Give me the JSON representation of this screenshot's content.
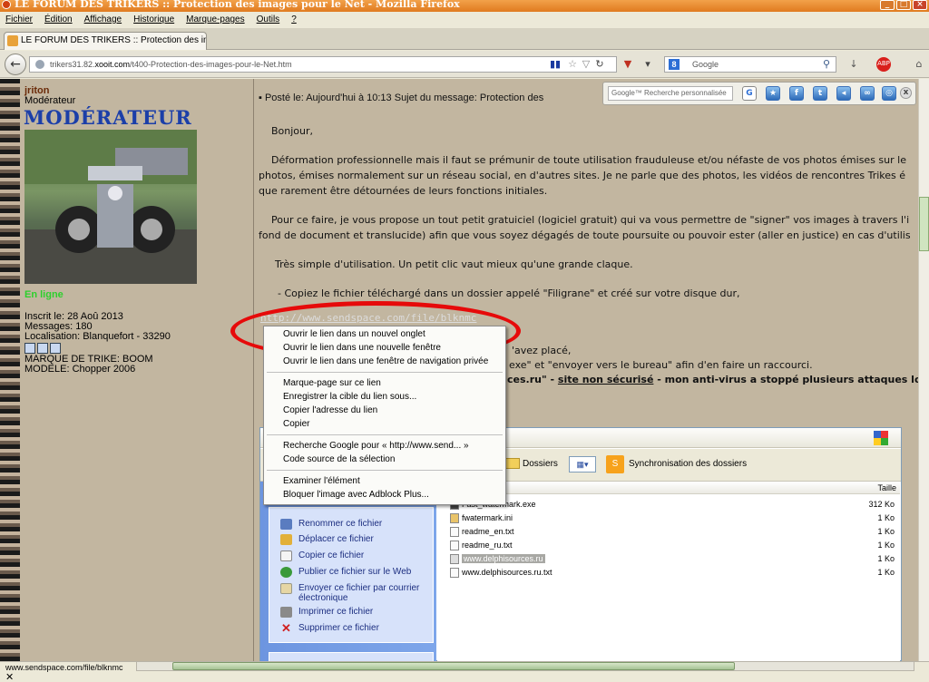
{
  "window": {
    "title": "LE FORUM DES TRIKERS :: Protection des images pour le Net - Mozilla Firefox"
  },
  "menubar": [
    "Fichier",
    "Édition",
    "Affichage",
    "Historique",
    "Marque-pages",
    "Outils",
    "?"
  ],
  "tab": {
    "label": "LE FORUM DES TRIKERS :: Protection des im..."
  },
  "nav": {
    "back_icon": "←",
    "url_prefix": "trikers31.82.",
    "url_domain": "xooit.com",
    "url_path": "/t400-Protection-des-images-pour-le-Net.htm",
    "search_engine_icon": "8",
    "search_placeholder": "Google"
  },
  "poster": {
    "name": "jriton",
    "rank": "Modérateur",
    "rank_image_text": "MODÉRATEUR",
    "status": "En ligne",
    "joined": "Inscrit le: 28 Aoû 2013",
    "messages": "Messages: 180",
    "location": "Localisation: Blanquefort - 33290",
    "trike": "MARQUE DE TRIKE: BOOM",
    "model": "MODELE: Chopper 2006"
  },
  "post": {
    "header": "Posté le: Aujourd'hui à 10:13    Sujet du message: Protection des",
    "lines": [
      "Bonjour,",
      "Déformation professionnelle mais il faut se prémunir de toute utilisation frauduleuse et/ou néfaste de vos photos émises sur le",
      "photos, émises normalement sur un réseau social, en d'autres sites. Je ne parle que des photos, les vidéos de rencontres Trikes é",
      "que rarement être détournées de leurs fonctions initiales.",
      "Pour ce faire, je vous propose un tout petit gratuiciel (logiciel gratuit) qui va vous permettre de \"signer\" vos images à travers l'i",
      "fond de document et translucide) afin que vous soyez dégagés de toute poursuite ou pouvoir ester (aller en justice) en cas d'utilis",
      "Très simple d'utilisation. Un petit clic vaut mieux qu'une grande claque.",
      "- Copiez le fichier téléchargé dans un dossier appelé \"Filigrane\" et créé sur votre disque dur,",
      "http://www.sendspace.com/file/blknmc",
      "'avez placé,",
      "exe\" et \"envoyer vers le bureau\" afin d'en faire un raccourci.",
      "ces.ru\" - ",
      "site non sécurisé",
      " - mon anti-virus a stoppé plusieurs attaques lors du"
    ]
  },
  "google_toolbar": {
    "search_label": "Google™ Recherche personnalisée",
    "buttons": [
      "G",
      "★",
      "f",
      "t",
      "◂",
      "∞",
      "◎",
      "x"
    ]
  },
  "context_menu": {
    "items": [
      "Ouvrir le lien dans un nouvel onglet",
      "Ouvrir le lien dans une nouvelle fenêtre",
      "Ouvrir le lien dans une fenêtre de navigation privée",
      "Marque-page sur ce lien",
      "Enregistrer la cible du lien sous...",
      "Copier l'adresse du lien",
      "Copier",
      "Recherche Google pour « http://www.send... »",
      "Code source de la sélection",
      "Examiner l'élément",
      "Bloquer l'image avec Adblock Plus..."
    ]
  },
  "explorer": {
    "toolbar": {
      "folders": "Dossiers",
      "sync": "Synchronisation des dossiers"
    },
    "tasks": [
      "Renommer ce fichier",
      "Déplacer ce fichier",
      "Copier ce fichier",
      "Publier ce fichier sur le Web",
      "Envoyer ce fichier par courrier",
      "électronique",
      "Imprimer ce fichier",
      "Supprimer ce fichier"
    ],
    "size_header": "Taille",
    "files": [
      {
        "name": "Fast_watermark.exe",
        "size": "312 Ko"
      },
      {
        "name": "fwatermark.ini",
        "size": "1 Ko"
      },
      {
        "name": "readme_en.txt",
        "size": "1 Ko"
      },
      {
        "name": "readme_ru.txt",
        "size": "1 Ko"
      },
      {
        "name": "www.delphisources.ru",
        "size": "1 Ko"
      },
      {
        "name": "www.delphisources.ru.txt",
        "size": "1 Ko"
      }
    ]
  },
  "status": {
    "text": "www.sendspace.com/file/blknmc",
    "close": "✕"
  },
  "colors": {
    "accent": "#e07b1f",
    "annotation": "#e60a0a",
    "online": "#2cd02c"
  }
}
